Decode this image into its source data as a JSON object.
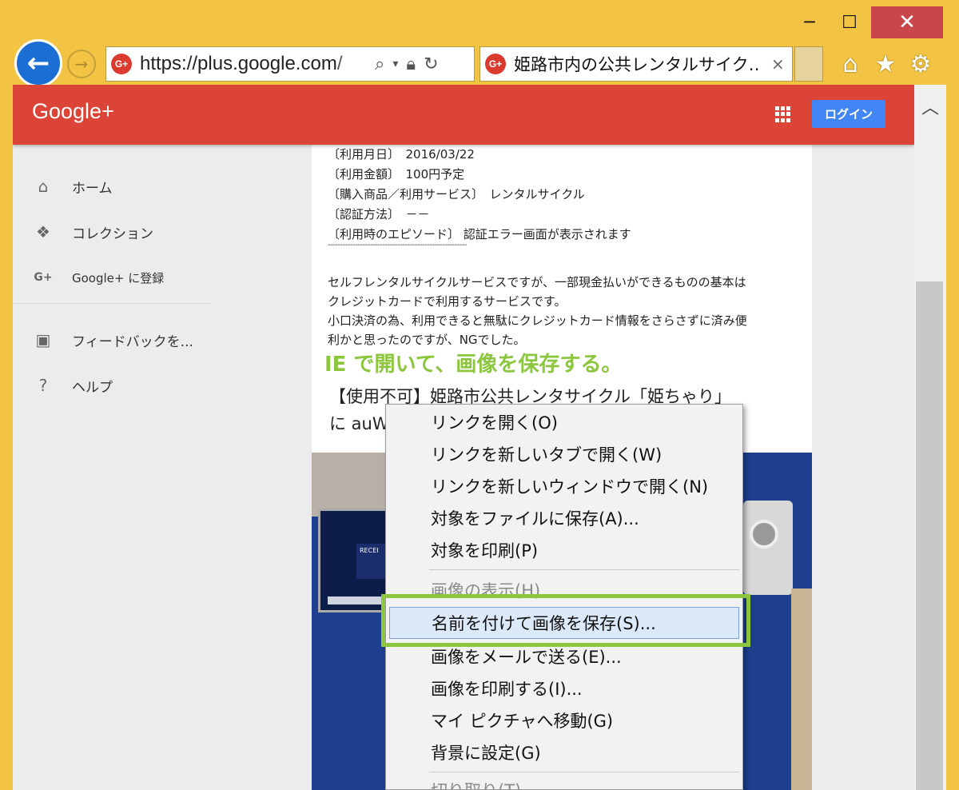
{
  "browser": {
    "address_url_host": "https://plus.google.com",
    "address_url_tail": "/",
    "tab_title": "姫路市内の公共レンタルサイク…",
    "tab_close": "×",
    "favicon_text": "G+",
    "window_minimize": "─",
    "window_maximize": "☐",
    "window_close": "✕",
    "back_glyph": "←",
    "forward_glyph": "→"
  },
  "header": {
    "logo": "Google+",
    "login_label": "ログイン",
    "brand_color": "#db4437",
    "login_color": "#4285f4"
  },
  "sidebar": {
    "items": [
      {
        "label": "ホーム",
        "icon": "home-icon"
      },
      {
        "label": "コレクション",
        "icon": "collections-icon"
      },
      {
        "label": "Google+ に登録",
        "icon": "gplus-icon"
      },
      {
        "label": "フィードバックを...",
        "icon": "feedback-icon"
      },
      {
        "label": "ヘルプ",
        "icon": "help-icon"
      }
    ]
  },
  "post": {
    "lines": [
      "〔利用月日〕　2016/03/22",
      "〔利用金額〕　100円予定",
      "〔購入商品／利用サービス〕　レンタルサイクル",
      "〔認証方法〕　－－",
      "〔利用時のエピソード〕 認証エラー画面が表示されます"
    ],
    "dashes": "--------------------------------------------------------",
    "body": [
      "セルフレンタルサイクルサービスですが、一部現金払いができるものの基本は",
      "クレジットカードで利用するサービスです。",
      "小口決済の為、利用できると無駄にクレジットカード情報をさらさずに済み便",
      "利かと思ったのですが、NGでした。"
    ],
    "overlay_note": "IE で開いて、画像を保存する。",
    "share_title_line1": "【使用不可】姫路市公共レンタサイクル「姫ちゃり」",
    "share_title_line2": "に auW",
    "photo_receipt_text": "RECEI"
  },
  "context_menu": {
    "items": [
      {
        "label": "リンクを開く(O)",
        "enabled": true
      },
      {
        "label": "リンクを新しいタブで開く(W)",
        "enabled": true
      },
      {
        "label": "リンクを新しいウィンドウで開く(N)",
        "enabled": true
      },
      {
        "label": "対象をファイルに保存(A)...",
        "enabled": true
      },
      {
        "label": "対象を印刷(P)",
        "enabled": true
      },
      {
        "label": "画像の表示(H)",
        "enabled": false
      },
      {
        "label": "名前を付けて画像を保存(S)...",
        "enabled": true,
        "highlighted": true
      },
      {
        "label": "画像をメールで送る(E)...",
        "enabled": true
      },
      {
        "label": "画像を印刷する(I)...",
        "enabled": true
      },
      {
        "label": "マイ ピクチャへ移動(G)",
        "enabled": true
      },
      {
        "label": "背景に設定(G)",
        "enabled": true
      },
      {
        "label": "切り取り(T)",
        "enabled": false
      }
    ],
    "callout_color": "#8cc63f"
  }
}
